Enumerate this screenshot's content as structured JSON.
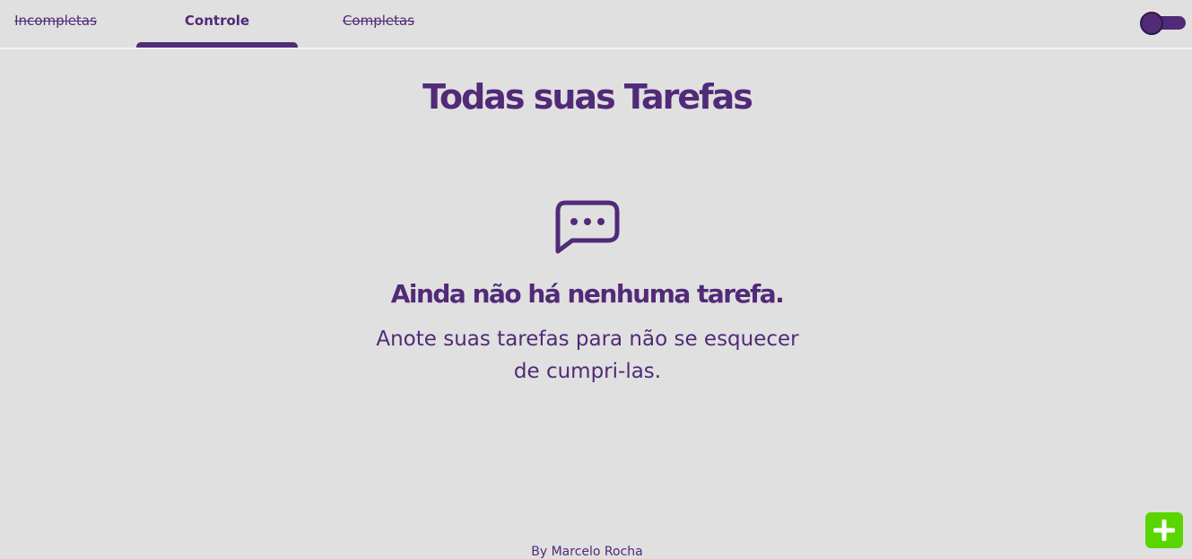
{
  "tabs": [
    {
      "label": "Incompletas"
    },
    {
      "label": "Controle"
    },
    {
      "label": "Completas"
    }
  ],
  "theme_toggle": {
    "icon": "toggle-switch"
  },
  "page": {
    "title": "Todas suas Tarefas"
  },
  "empty_state": {
    "icon": "chat-bubble-dots-icon",
    "title": "Ainda não há nenhuma tarefa.",
    "line1": "Anote suas tarefas para não se esquecer",
    "line2": "de cumpri-las."
  },
  "add_button": {
    "icon": "plus-icon"
  },
  "footer": {
    "text": "By Marcelo Rocha"
  },
  "colors": {
    "primary": "#512a78",
    "background": "#e0e0e0",
    "add_button": "#59d500"
  }
}
